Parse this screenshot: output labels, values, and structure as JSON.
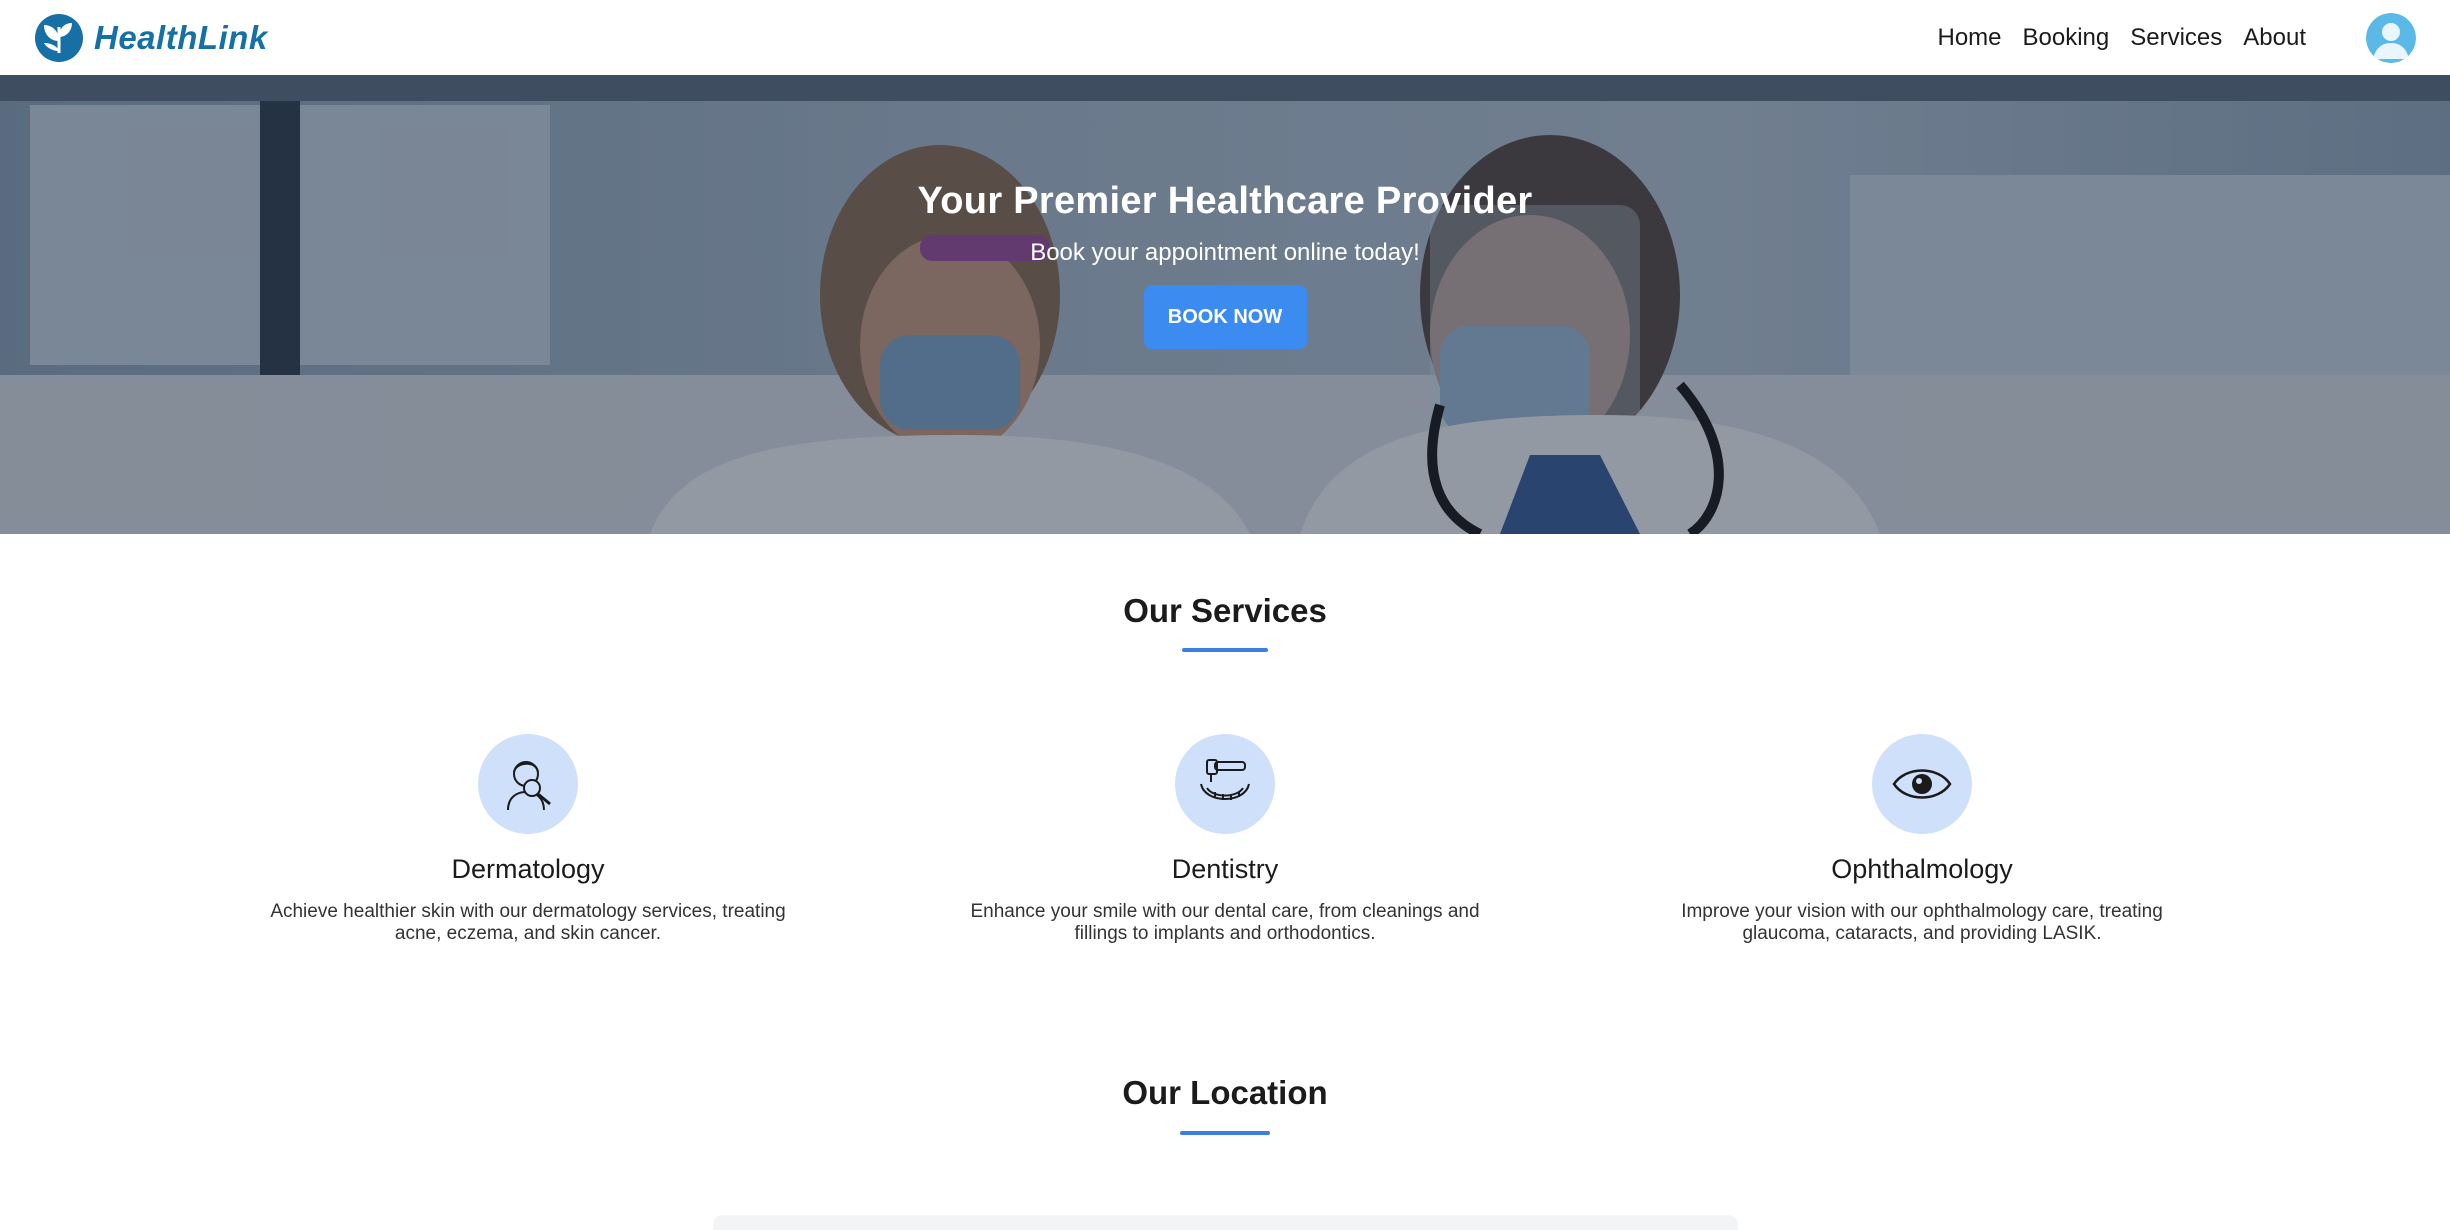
{
  "header": {
    "brand_name": "HealthLink",
    "nav": [
      "Home",
      "Booking",
      "Services",
      "About"
    ]
  },
  "hero": {
    "title": "Your Premier Healthcare Provider",
    "subtitle": "Book your appointment online today!",
    "button_label": "BOOK NOW"
  },
  "services_section": {
    "title": "Our Services",
    "items": [
      {
        "name": "Dermatology",
        "icon": "dermatology-icon",
        "description_line1": "Achieve healthier skin with our dermatology services, treating",
        "description_line2": "acne, eczema, and skin cancer."
      },
      {
        "name": "Dentistry",
        "icon": "dentistry-icon",
        "description_line1": "Enhance your smile with our dental care, from cleanings and",
        "description_line2": "fillings to implants and orthodontics."
      },
      {
        "name": "Ophthalmology",
        "icon": "eye-icon",
        "description_line1": "Improve your vision with our ophthalmology care, treating",
        "description_line2": "glaucoma, cataracts, and providing LASIK."
      }
    ]
  },
  "location_section": {
    "title": "Our Location"
  },
  "colors": {
    "brand": "#1670a6",
    "accent": "#3b8bf0",
    "icon_bg": "#cfe0fb"
  }
}
